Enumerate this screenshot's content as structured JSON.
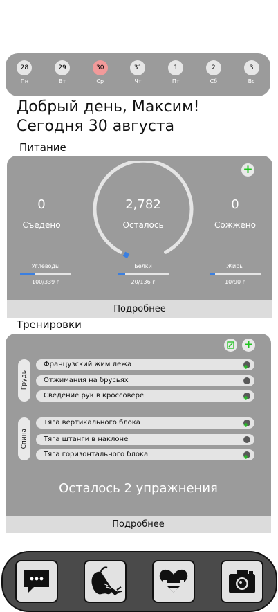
{
  "calendar": {
    "days": [
      {
        "num": "28",
        "label": "Пн"
      },
      {
        "num": "29",
        "label": "Вт"
      },
      {
        "num": "30",
        "label": "Ср"
      },
      {
        "num": "31",
        "label": "Чт"
      },
      {
        "num": "1",
        "label": "Пт"
      },
      {
        "num": "2",
        "label": "Сб"
      },
      {
        "num": "3",
        "label": "Вс"
      }
    ],
    "active_color": "#f29a9a"
  },
  "greeting": {
    "line1": "Добрый день, Максим!",
    "line2": "Сегодня 30 августа"
  },
  "nutrition": {
    "title": "Питание",
    "eaten_value": "0",
    "eaten_label": "Съедено",
    "remaining_value": "2,782",
    "remaining_label": "Осталось",
    "burned_value": "0",
    "burned_label": "Сожжено",
    "remaining_fraction": 1.0,
    "macros": [
      {
        "name": "Углеводы",
        "value": "100/339 г",
        "fraction": 0.295
      },
      {
        "name": "Белки",
        "value": "20/136 г",
        "fraction": 0.147
      },
      {
        "name": "Жиры",
        "value": "10/90 г",
        "fraction": 0.111
      }
    ],
    "more_label": "Подробнее",
    "add_icon": "plus-icon"
  },
  "workouts": {
    "title": "Тренировки",
    "groups": [
      {
        "name": "Грудь",
        "exercises": [
          "Французский жим лежа",
          "Отжимания на брусьях",
          "Сведение рук в кроссовере"
        ]
      },
      {
        "name": "Спина",
        "exercises": [
          "Тяга вертикального блока",
          "Тяга штанги в наклоне",
          "Тяга горизонтального блока"
        ]
      }
    ],
    "remaining_text": "Осталось 2 упражнения",
    "more_label": "Подробнее"
  },
  "nav": {
    "items": [
      "chat-icon",
      "food-icon",
      "workout-icon",
      "camera-icon"
    ]
  },
  "colors": {
    "card": "#9b9b9b",
    "accent_green": "#21c421",
    "accent_blue": "#3b7fe0",
    "today": "#f29a9a"
  }
}
